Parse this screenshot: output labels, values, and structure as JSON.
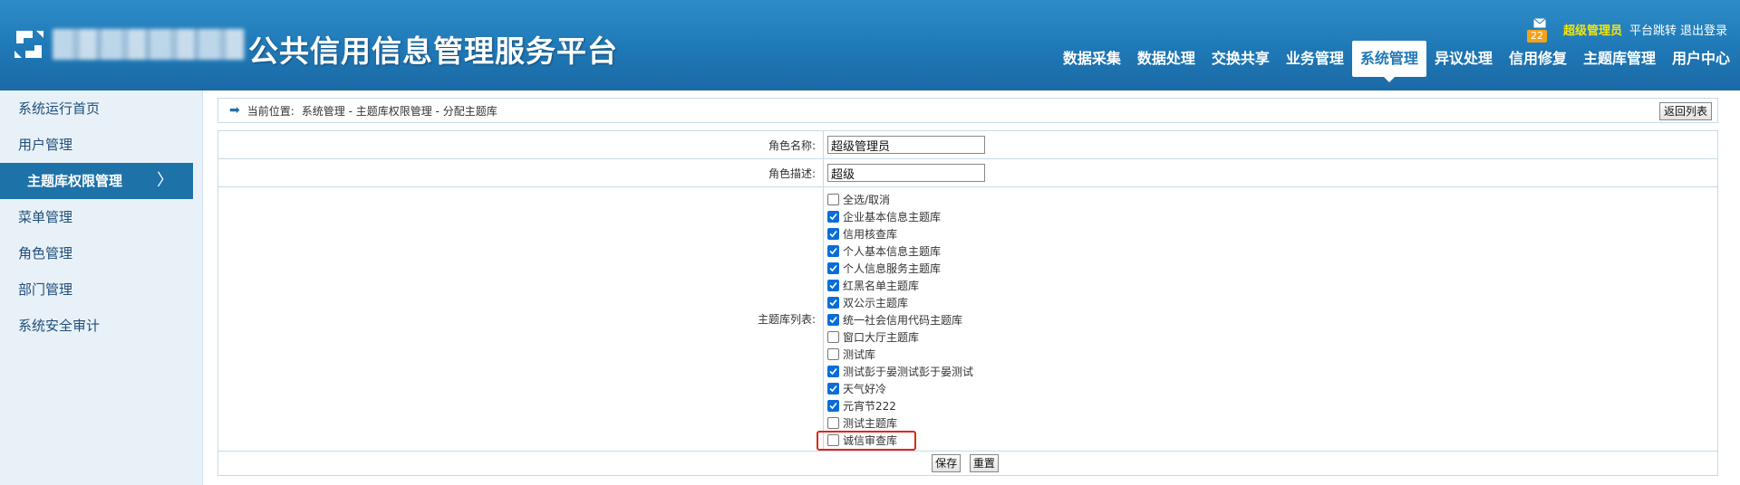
{
  "header": {
    "title": "公共信用信息管理服务平台",
    "mail_count": "22",
    "user_name": "超级管理员",
    "links": [
      "平台跳转",
      "退出登录"
    ],
    "nav": [
      {
        "label": "数据采集",
        "active": false
      },
      {
        "label": "数据处理",
        "active": false
      },
      {
        "label": "交换共享",
        "active": false
      },
      {
        "label": "业务管理",
        "active": false
      },
      {
        "label": "系统管理",
        "active": true
      },
      {
        "label": "异议处理",
        "active": false
      },
      {
        "label": "信用修复",
        "active": false
      },
      {
        "label": "主题库管理",
        "active": false
      },
      {
        "label": "用户中心",
        "active": false
      }
    ]
  },
  "sidebar": {
    "items": [
      {
        "label": "系统运行首页",
        "active": false
      },
      {
        "label": "用户管理",
        "active": false
      },
      {
        "label": "主题库权限管理",
        "active": true
      },
      {
        "label": "菜单管理",
        "active": false
      },
      {
        "label": "角色管理",
        "active": false
      },
      {
        "label": "部门管理",
        "active": false
      },
      {
        "label": "系统安全审计",
        "active": false
      }
    ]
  },
  "breadcrumb": {
    "label": "当前位置:",
    "path": "系统管理 - 主题库权限管理 - 分配主题库",
    "back_button": "返回列表"
  },
  "form": {
    "role_name_label": "角色名称:",
    "role_name_value": "超级管理员",
    "role_desc_label": "角色描述:",
    "role_desc_value": "超级",
    "list_label": "主题库列表:",
    "select_all": "全选/取消",
    "libraries": [
      {
        "label": "企业基本信息主题库",
        "checked": true
      },
      {
        "label": "信用核查库",
        "checked": true
      },
      {
        "label": "个人基本信息主题库",
        "checked": true
      },
      {
        "label": "个人信息服务主题库",
        "checked": true
      },
      {
        "label": "红黑名单主题库",
        "checked": true
      },
      {
        "label": "双公示主题库",
        "checked": true
      },
      {
        "label": "统一社会信用代码主题库",
        "checked": true
      },
      {
        "label": "窗口大厅主题库",
        "checked": false
      },
      {
        "label": "测试库",
        "checked": false
      },
      {
        "label": "测试彭于晏测试彭于晏测试",
        "checked": true
      },
      {
        "label": "天气好冷",
        "checked": true
      },
      {
        "label": "元宵节222",
        "checked": true
      },
      {
        "label": "测试主题库",
        "checked": false
      },
      {
        "label": "诚信审查库",
        "checked": false
      }
    ],
    "save_label": "保存",
    "reset_label": "重置"
  },
  "colors": {
    "header_blue": "#1f78b6",
    "sidebar_active": "#1d72a8",
    "user_name": "#f5e60a",
    "highlight_border": "#e0251b",
    "checkbox_checked": "#0a6dd7"
  }
}
